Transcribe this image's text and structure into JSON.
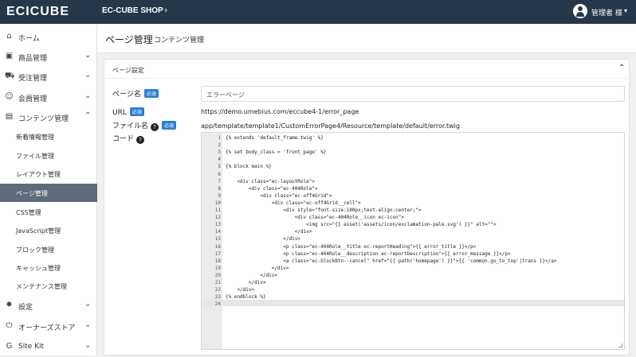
{
  "header": {
    "logo": "ECICUBE",
    "shop_name": "EC-CUBE SHOP",
    "shop_chevron": "›",
    "user_label": "管理者 様",
    "user_chevron": "▾"
  },
  "sidebar": {
    "items": [
      {
        "label": "ホーム",
        "icon": "⌂",
        "chev": ""
      },
      {
        "label": "商品管理",
        "icon": "▣",
        "chev": "⌄"
      },
      {
        "label": "受注管理",
        "icon": "⛟",
        "chev": "⌄"
      },
      {
        "label": "会員管理",
        "icon": "☺",
        "chev": "⌄"
      },
      {
        "label": "コンテンツ管理",
        "icon": "▤",
        "chev": "⌃"
      }
    ],
    "sub_items": [
      {
        "label": "新着情報管理"
      },
      {
        "label": "ファイル管理"
      },
      {
        "label": "レイアウト管理"
      },
      {
        "label": "ページ管理"
      },
      {
        "label": "CSS管理"
      },
      {
        "label": "JavaScript管理"
      },
      {
        "label": "ブロック管理"
      },
      {
        "label": "キャッシュ管理"
      },
      {
        "label": "メンテナンス管理"
      }
    ],
    "bottom_items": [
      {
        "label": "設定",
        "icon": "✹",
        "chev": "⌄"
      },
      {
        "label": "オーナーズストア",
        "icon": "⏻",
        "chev": "⌄"
      },
      {
        "label": "Site Kit",
        "icon": "G",
        "chev": "⌄"
      }
    ]
  },
  "page": {
    "title": "ページ管理",
    "subtitle": "コンテンツ管理"
  },
  "card": {
    "title": "ページ設定",
    "chevron": "⌃",
    "page_name_label": "ページ名",
    "required": "必須",
    "page_name_value": "エラーページ",
    "url_label": "URL",
    "url_value": "https://demo.umebius.com/eccube4-1/error_page",
    "file_label": "ファイル名",
    "file_value": "app/template/template1/CustomErrorPage4/Resource/template/default/error.twig",
    "code_label": "コード",
    "help": "?"
  },
  "code_lines": [
    "{% extends 'default_frame.twig' %}",
    "",
    "{% set body_class = 'front_page' %}",
    "",
    "{% block main %}",
    "",
    "    <div class=\"ec-layoutRole\">",
    "        <div class=\"ec-404Role\">",
    "            <div class=\"ec-off4Grid\">",
    "                <div class=\"ec-off4Grid__cell\">",
    "                    <div style=\"font-size:100px;text-align:center;\">",
    "                        <div class=\"ec-404Role__icon ec-icon\">",
    "                            <img src=\"{{ asset('assets/icon/exclamation-pale.svg') }}\" alt=\"\">",
    "                        </div>",
    "                    </div>",
    "                    <p class=\"ec-404Role__title ec-reportHeading\">{{ error_title }}</p>",
    "                    <p class=\"ec-404Role__description ec-reportDescription\">{{ error_message }}</p>",
    "                    <a class=\"ec-blockBtn--cancel\" href=\"{{ path('homepage') }}\">{{ 'common.go_to_top'|trans }}</a>",
    "                </div>",
    "            </div>",
    "        </div>",
    "    </div>",
    "{% endblock %}",
    ""
  ],
  "colors": {
    "topbar": "#27374a",
    "accent": "#2c7fd3",
    "active_nav": "#5f6b7a"
  }
}
